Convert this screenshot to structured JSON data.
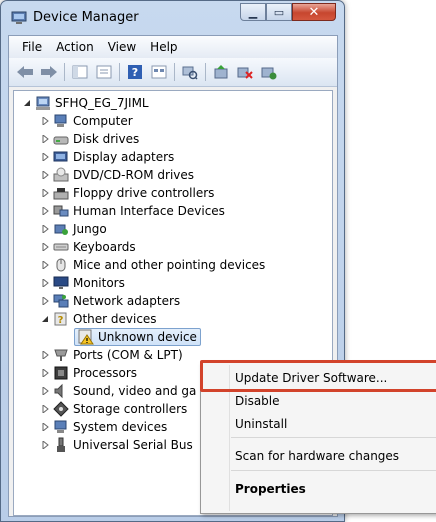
{
  "window": {
    "title": "Device Manager"
  },
  "menubar": {
    "items": [
      "File",
      "Action",
      "View",
      "Help"
    ]
  },
  "toolbar": {
    "buttons": [
      "back-icon",
      "forward-icon",
      "show-hide-console-tree-icon",
      "properties-icon",
      "help-icon",
      "view-icon",
      "scan-hardware-icon",
      "update-driver-icon",
      "uninstall-icon",
      "enable-device-icon"
    ]
  },
  "tree": {
    "root": "SFHQ_EG_7JIML",
    "items": [
      {
        "label": "Computer",
        "icon": "computer-icon"
      },
      {
        "label": "Disk drives",
        "icon": "disk-drive-icon"
      },
      {
        "label": "Display adapters",
        "icon": "display-adapter-icon"
      },
      {
        "label": "DVD/CD-ROM drives",
        "icon": "dvd-drive-icon"
      },
      {
        "label": "Floppy drive controllers",
        "icon": "floppy-icon"
      },
      {
        "label": "Human Interface Devices",
        "icon": "hid-icon"
      },
      {
        "label": "Jungo",
        "icon": "jungo-icon"
      },
      {
        "label": "Keyboards",
        "icon": "keyboard-icon"
      },
      {
        "label": "Mice and other pointing devices",
        "icon": "mouse-icon"
      },
      {
        "label": "Monitors",
        "icon": "monitor-icon"
      },
      {
        "label": "Network adapters",
        "icon": "network-icon"
      },
      {
        "label": "Other devices",
        "icon": "other-devices-icon",
        "expanded": true
      },
      {
        "label": "Unknown device",
        "icon": "unknown-device-warning-icon",
        "child": true,
        "selected": true
      },
      {
        "label": "Ports (COM & LPT)",
        "icon": "port-icon"
      },
      {
        "label": "Processors",
        "icon": "processor-icon"
      },
      {
        "label": "Sound, video and ga",
        "icon": "sound-icon"
      },
      {
        "label": "Storage controllers",
        "icon": "storage-icon"
      },
      {
        "label": "System devices",
        "icon": "system-devices-icon"
      },
      {
        "label": "Universal Serial Bus",
        "icon": "usb-icon"
      }
    ]
  },
  "context_menu": {
    "items": [
      "Update Driver Software...",
      "Disable",
      "Uninstall",
      "Scan for hardware changes",
      "Properties"
    ],
    "highlight_color": "#d2432b"
  }
}
